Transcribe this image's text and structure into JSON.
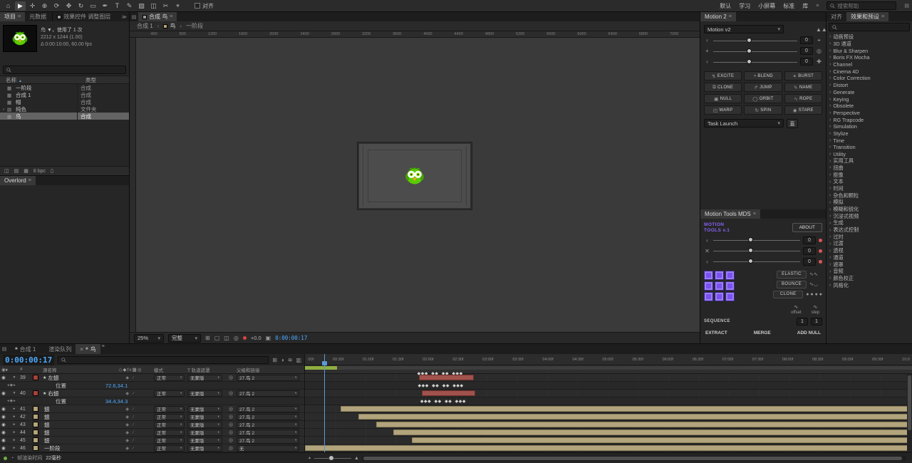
{
  "icons": {
    "menu": "≡",
    "overflow": "≫",
    "caret": "▾",
    "sort_up": "▲",
    "eye": "◉",
    "link": "◎",
    "keynav": "◂◆▸",
    "switches": "◆ ∕",
    "panel": "▤",
    "trash": "▯",
    "twirl_r": "›",
    "bc_left": "‹",
    "bc_right": "›",
    "mountains": "▲▲",
    "camera": "▣"
  },
  "topbar": {
    "tools": [
      {
        "glyph": "⌂",
        "name": "home",
        "cls": ""
      },
      {
        "glyph": "▶",
        "name": "selection",
        "cls": "active"
      },
      {
        "glyph": "✛",
        "name": "hand",
        "cls": ""
      },
      {
        "glyph": "⊕",
        "name": "zoom",
        "cls": ""
      },
      {
        "glyph": "⟳",
        "name": "orbit",
        "cls": ""
      },
      {
        "glyph": "✥",
        "name": "pan-camera",
        "cls": ""
      },
      {
        "glyph": "↻",
        "name": "rotate",
        "cls": ""
      },
      {
        "glyph": "▭",
        "name": "shape",
        "cls": ""
      },
      {
        "glyph": "✒",
        "name": "pen",
        "cls": ""
      },
      {
        "glyph": "T",
        "name": "type",
        "cls": ""
      },
      {
        "glyph": "✎",
        "name": "brush",
        "cls": ""
      },
      {
        "glyph": "▨",
        "name": "stamp",
        "cls": ""
      },
      {
        "glyph": "◫",
        "name": "eraser",
        "cls": ""
      },
      {
        "glyph": "✂",
        "name": "roto-brush",
        "cls": ""
      },
      {
        "glyph": "⌖",
        "name": "puppet",
        "cls": ""
      }
    ],
    "snap_label": "对齐",
    "workspaces": [
      "默认",
      "学习",
      "小屏幕",
      "标准",
      "库"
    ],
    "search_placeholder": "搜索帮助"
  },
  "project": {
    "tabs": [
      "项目",
      "元数据"
    ],
    "effect_controls_tab": "效果控件 调整图层",
    "info": {
      "line1": "鸟 ▼，使用了 1 次",
      "line2": "2212 x 1244 (1.00)",
      "line3": "Δ 0:00:10:00, 60.00 fps"
    },
    "columns": {
      "name": "名称",
      "type": "类型"
    },
    "items": [
      {
        "twirl": "",
        "icon": "comp",
        "name": "一阶段",
        "type": "合成",
        "row_cls": ""
      },
      {
        "twirl": "",
        "icon": "comp",
        "name": "合成 1",
        "type": "合成",
        "row_cls": ""
      },
      {
        "twirl": "",
        "icon": "comp",
        "name": "帽",
        "type": "合成",
        "row_cls": ""
      },
      {
        "twirl": "›",
        "icon": "folder",
        "name": "纯色",
        "type": "文件夹",
        "row_cls": ""
      },
      {
        "twirl": "",
        "icon": "comp",
        "name": "鸟",
        "type": "合成",
        "row_cls": "selected"
      }
    ],
    "bit_depth": "8 bpc"
  },
  "overlord": {
    "title": "Overlord"
  },
  "viewer": {
    "tab": "合成 鸟",
    "breadcrumb": {
      "prev": "合成 1",
      "current": "鸟",
      "next": "一阶段"
    },
    "ruler_labels": [
      "400",
      "800",
      "1200",
      "1600",
      "2000",
      "2400",
      "2800",
      "3200",
      "3600",
      "4000",
      "4400",
      "4800",
      "5200",
      "5600",
      "6000",
      "6400",
      "6800",
      "7200"
    ],
    "zoom": "25%",
    "resolution": "完整",
    "exposure": "+0.0",
    "timecode": "0:00:00:17"
  },
  "motion": {
    "title": "Motion 2",
    "preset": "Motion v2",
    "sliders": [
      {
        "glyph": "‹",
        "value": "0",
        "right": "⌖"
      },
      {
        "glyph": "+",
        "value": "0",
        "right": "◎"
      },
      {
        "glyph": "›",
        "value": "0",
        "right": "✚"
      }
    ],
    "buttons": [
      {
        "glyph": "↯",
        "label": "EXCITE"
      },
      {
        "glyph": "◑",
        "label": "BLEND"
      },
      {
        "glyph": "✶",
        "label": "BURST"
      },
      {
        "glyph": "⧉",
        "label": "CLONE"
      },
      {
        "glyph": "↱",
        "label": "JUMP"
      },
      {
        "glyph": "✎",
        "label": "NAME"
      },
      {
        "glyph": "▣",
        "label": "NULL"
      },
      {
        "glyph": "◯",
        "label": "ORBIT"
      },
      {
        "glyph": "∿",
        "label": "ROPE"
      },
      {
        "glyph": "◰",
        "label": "WARP"
      },
      {
        "glyph": "↻",
        "label": "SPIN"
      },
      {
        "glyph": "◉",
        "label": "STARE"
      }
    ],
    "task_launch": "Task Launch",
    "task_button": "直"
  },
  "motion_tools": {
    "title": "Motion Tools MDS",
    "brand1": "MOTION",
    "brand2": "TOOLS v.1",
    "about": "ABOUT",
    "sliders": [
      {
        "glyph": "‹",
        "value": "0"
      },
      {
        "glyph": "✕",
        "value": "0"
      },
      {
        "glyph": "›",
        "value": "0"
      }
    ],
    "easing": [
      {
        "label": "ELASTIC",
        "icon": "∿∿"
      },
      {
        "label": "BOUNCE",
        "icon": "∿◡"
      },
      {
        "label": "CLONE",
        "icon": "● ● ● ●"
      }
    ],
    "offset_label": "offset",
    "step_label": "step",
    "sequence_label": "SEQUENCE",
    "sequence_values": [
      "1",
      "1"
    ],
    "footer": [
      "EXTRACT",
      "MERGE",
      "ADD NULL"
    ]
  },
  "effects": {
    "tabs": [
      "对齐",
      "效果和预设"
    ],
    "categories": [
      "动画预设",
      "3D 通道",
      "Blur & Sharpen",
      "Boris FX Mocha",
      "Channel",
      "Cinema 4D",
      "Color Correction",
      "Distort",
      "Generate",
      "Keying",
      "Obsolete",
      "Perspective",
      "RG Trapcode",
      "Simulation",
      "Stylize",
      "Time",
      "Transition",
      "Utility",
      "实用工具",
      "扭曲",
      "抠像",
      "文本",
      "时间",
      "杂色和颗粒",
      "模拟",
      "模糊和锐化",
      "沉浸式视频",
      "生成",
      "表达式控制",
      "过时",
      "过渡",
      "透视",
      "通道",
      "遮罩",
      "音频",
      "颜色校正",
      "风格化"
    ]
  },
  "timeline": {
    "tabs": [
      {
        "chip": "■",
        "label": "合成 1",
        "close": "",
        "cls": ""
      },
      {
        "chip": "",
        "label": "渲染队列",
        "close": "",
        "cls": ""
      },
      {
        "chip": "■",
        "label": "鸟",
        "close": "×",
        "cls": "active"
      }
    ],
    "timecode": "0:00:00:17",
    "panel_icons": [
      "⊞",
      "◑",
      "≋",
      "▥"
    ],
    "header": {
      "av": "◉♦",
      "num": "#",
      "source": "源名称",
      "switches": "◇◆fx▦◎",
      "mode": "模式",
      "matte": "T 轨道遮罩",
      "parent": "父级和链接"
    },
    "rows": [
      {
        "cls": "k-layer",
        "num": "39",
        "twirl": "▾",
        "ni": "★",
        "name": "左翅",
        "swatch": "#a8403a",
        "mode": "正常",
        "matte": "无蒙版",
        "parent": "27.鸟 2",
        "bar_left": "18.8%",
        "bar_width": "9%",
        "bar_cls": "red"
      },
      {
        "cls": "k-prop",
        "plabel": "位置",
        "pvalue": "72.6,34.1",
        "keys": "◆◆◆  ◆◆  ◆◆  ◆◆◆",
        "keys_left": "18.6%"
      },
      {
        "cls": "k-layer",
        "num": "40",
        "twirl": "▾",
        "ni": "★",
        "name": "右翅",
        "swatch": "#a8403a",
        "mode": "正常",
        "matte": "无蒙版",
        "parent": "27.鸟 2",
        "bar_left": "19.2%",
        "bar_width": "8.9%",
        "bar_cls": "red"
      },
      {
        "cls": "k-prop",
        "plabel": "位置",
        "pvalue": "34.4,34.3",
        "keys": "◆◆◆  ◆◆  ◆◆  ◆◆◆",
        "keys_left": "19%"
      },
      {
        "cls": "k-layer",
        "num": "41",
        "twirl": "▸",
        "ni": "",
        "name": "翅",
        "swatch": "#b3a477",
        "mode": "正常",
        "matte": "无蒙版",
        "parent": "27.鸟 2",
        "bar_left": "5.9%",
        "bar_width": "93.5%",
        "bar_cls": "tan"
      },
      {
        "cls": "k-layer",
        "num": "42",
        "twirl": "▸",
        "ni": "",
        "name": "翅",
        "swatch": "#b3a477",
        "mode": "正常",
        "matte": "无蒙版",
        "parent": "27.鸟 2",
        "bar_left": "8.8%",
        "bar_width": "90.6%",
        "bar_cls": "tan"
      },
      {
        "cls": "k-layer",
        "num": "43",
        "twirl": "▸",
        "ni": "",
        "name": "翅",
        "swatch": "#b3a477",
        "mode": "正常",
        "matte": "无蒙版",
        "parent": "27.鸟 2",
        "bar_left": "11.7%",
        "bar_width": "87.7%",
        "bar_cls": "tan"
      },
      {
        "cls": "k-layer",
        "num": "44",
        "twirl": "▸",
        "ni": "",
        "name": "翅",
        "swatch": "#b3a477",
        "mode": "正常",
        "matte": "无蒙版",
        "parent": "27.鸟 2",
        "bar_left": "14.6%",
        "bar_width": "84.8%",
        "bar_cls": "tan"
      },
      {
        "cls": "k-layer",
        "num": "45",
        "twirl": "▸",
        "ni": "",
        "name": "翅",
        "swatch": "#b3a477",
        "mode": "正常",
        "matte": "无蒙版",
        "parent": "27.鸟 2",
        "bar_left": "17.6%",
        "bar_width": "81.8%",
        "bar_cls": "tan"
      },
      {
        "cls": "k-layer",
        "num": "46",
        "twirl": "▸",
        "ni": "",
        "name": "一阶段",
        "swatch": "#b3a477",
        "mode": "正常",
        "matte": "无蒙版",
        "parent": "无",
        "bar_left": "0%",
        "bar_width": "99.4%",
        "bar_cls": "tan"
      }
    ],
    "ruler": [
      ":00f",
      "00:30f",
      "01:00f",
      "01:30f",
      "02:00f",
      "02:30f",
      "03:00f",
      "03:30f",
      "04:00f",
      "04:30f",
      "05:00f",
      "05:30f",
      "06:00f",
      "06:30f",
      "07:00f",
      "07:30f",
      "08:00f",
      "08:30f",
      "09:00f",
      "09:30f",
      "10:0"
    ],
    "band_keys": "◆◆◆  ◆◆  ◆◆  ◆◆◆",
    "status_label": "帧渲染时间",
    "status_value": "22毫秒"
  }
}
